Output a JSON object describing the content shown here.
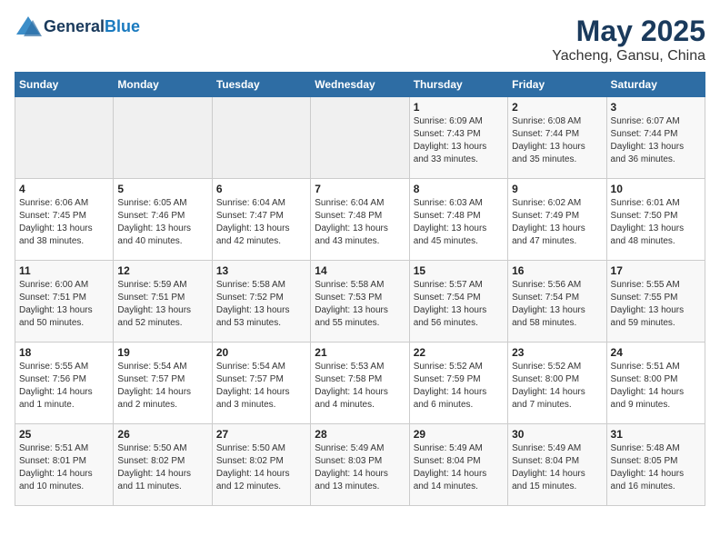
{
  "header": {
    "logo_line1": "General",
    "logo_line2": "Blue",
    "title": "May 2025",
    "subtitle": "Yacheng, Gansu, China"
  },
  "weekdays": [
    "Sunday",
    "Monday",
    "Tuesday",
    "Wednesday",
    "Thursday",
    "Friday",
    "Saturday"
  ],
  "weeks": [
    [
      {
        "day": "",
        "info": ""
      },
      {
        "day": "",
        "info": ""
      },
      {
        "day": "",
        "info": ""
      },
      {
        "day": "",
        "info": ""
      },
      {
        "day": "1",
        "info": "Sunrise: 6:09 AM\nSunset: 7:43 PM\nDaylight: 13 hours\nand 33 minutes."
      },
      {
        "day": "2",
        "info": "Sunrise: 6:08 AM\nSunset: 7:44 PM\nDaylight: 13 hours\nand 35 minutes."
      },
      {
        "day": "3",
        "info": "Sunrise: 6:07 AM\nSunset: 7:44 PM\nDaylight: 13 hours\nand 36 minutes."
      }
    ],
    [
      {
        "day": "4",
        "info": "Sunrise: 6:06 AM\nSunset: 7:45 PM\nDaylight: 13 hours\nand 38 minutes."
      },
      {
        "day": "5",
        "info": "Sunrise: 6:05 AM\nSunset: 7:46 PM\nDaylight: 13 hours\nand 40 minutes."
      },
      {
        "day": "6",
        "info": "Sunrise: 6:04 AM\nSunset: 7:47 PM\nDaylight: 13 hours\nand 42 minutes."
      },
      {
        "day": "7",
        "info": "Sunrise: 6:04 AM\nSunset: 7:48 PM\nDaylight: 13 hours\nand 43 minutes."
      },
      {
        "day": "8",
        "info": "Sunrise: 6:03 AM\nSunset: 7:48 PM\nDaylight: 13 hours\nand 45 minutes."
      },
      {
        "day": "9",
        "info": "Sunrise: 6:02 AM\nSunset: 7:49 PM\nDaylight: 13 hours\nand 47 minutes."
      },
      {
        "day": "10",
        "info": "Sunrise: 6:01 AM\nSunset: 7:50 PM\nDaylight: 13 hours\nand 48 minutes."
      }
    ],
    [
      {
        "day": "11",
        "info": "Sunrise: 6:00 AM\nSunset: 7:51 PM\nDaylight: 13 hours\nand 50 minutes."
      },
      {
        "day": "12",
        "info": "Sunrise: 5:59 AM\nSunset: 7:51 PM\nDaylight: 13 hours\nand 52 minutes."
      },
      {
        "day": "13",
        "info": "Sunrise: 5:58 AM\nSunset: 7:52 PM\nDaylight: 13 hours\nand 53 minutes."
      },
      {
        "day": "14",
        "info": "Sunrise: 5:58 AM\nSunset: 7:53 PM\nDaylight: 13 hours\nand 55 minutes."
      },
      {
        "day": "15",
        "info": "Sunrise: 5:57 AM\nSunset: 7:54 PM\nDaylight: 13 hours\nand 56 minutes."
      },
      {
        "day": "16",
        "info": "Sunrise: 5:56 AM\nSunset: 7:54 PM\nDaylight: 13 hours\nand 58 minutes."
      },
      {
        "day": "17",
        "info": "Sunrise: 5:55 AM\nSunset: 7:55 PM\nDaylight: 13 hours\nand 59 minutes."
      }
    ],
    [
      {
        "day": "18",
        "info": "Sunrise: 5:55 AM\nSunset: 7:56 PM\nDaylight: 14 hours\nand 1 minute."
      },
      {
        "day": "19",
        "info": "Sunrise: 5:54 AM\nSunset: 7:57 PM\nDaylight: 14 hours\nand 2 minutes."
      },
      {
        "day": "20",
        "info": "Sunrise: 5:54 AM\nSunset: 7:57 PM\nDaylight: 14 hours\nand 3 minutes."
      },
      {
        "day": "21",
        "info": "Sunrise: 5:53 AM\nSunset: 7:58 PM\nDaylight: 14 hours\nand 4 minutes."
      },
      {
        "day": "22",
        "info": "Sunrise: 5:52 AM\nSunset: 7:59 PM\nDaylight: 14 hours\nand 6 minutes."
      },
      {
        "day": "23",
        "info": "Sunrise: 5:52 AM\nSunset: 8:00 PM\nDaylight: 14 hours\nand 7 minutes."
      },
      {
        "day": "24",
        "info": "Sunrise: 5:51 AM\nSunset: 8:00 PM\nDaylight: 14 hours\nand 9 minutes."
      }
    ],
    [
      {
        "day": "25",
        "info": "Sunrise: 5:51 AM\nSunset: 8:01 PM\nDaylight: 14 hours\nand 10 minutes."
      },
      {
        "day": "26",
        "info": "Sunrise: 5:50 AM\nSunset: 8:02 PM\nDaylight: 14 hours\nand 11 minutes."
      },
      {
        "day": "27",
        "info": "Sunrise: 5:50 AM\nSunset: 8:02 PM\nDaylight: 14 hours\nand 12 minutes."
      },
      {
        "day": "28",
        "info": "Sunrise: 5:49 AM\nSunset: 8:03 PM\nDaylight: 14 hours\nand 13 minutes."
      },
      {
        "day": "29",
        "info": "Sunrise: 5:49 AM\nSunset: 8:04 PM\nDaylight: 14 hours\nand 14 minutes."
      },
      {
        "day": "30",
        "info": "Sunrise: 5:49 AM\nSunset: 8:04 PM\nDaylight: 14 hours\nand 15 minutes."
      },
      {
        "day": "31",
        "info": "Sunrise: 5:48 AM\nSunset: 8:05 PM\nDaylight: 14 hours\nand 16 minutes."
      }
    ]
  ]
}
